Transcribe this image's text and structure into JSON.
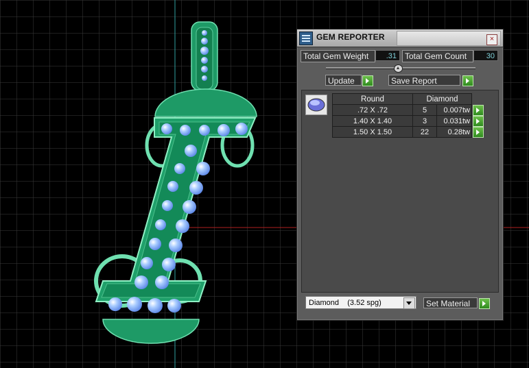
{
  "panel": {
    "title": "GEM REPORTER",
    "close_label": "×",
    "total_gem_weight_label": "Total Gem Weight",
    "total_gem_weight_value": ".31",
    "total_gem_count_label": "Total Gem Count",
    "total_gem_count_value": "30",
    "update_label": "Update",
    "save_report_label": "Save Report",
    "table": {
      "shape_header": "Round",
      "material_header": "Diamond",
      "rows": [
        {
          "size": ".72 X .72",
          "count": "5",
          "weight": "0.007tw"
        },
        {
          "size": "1.40 X 1.40",
          "count": "3",
          "weight": "0.031tw"
        },
        {
          "size": "1.50 X 1.50",
          "count": "22",
          "weight": "0.28tw"
        }
      ]
    },
    "material_select": "Diamond    (3.52 spg)",
    "set_material_label": "Set Material"
  },
  "colors": {
    "grid": "#3a3a3a",
    "model_green": "#1fa06a",
    "gem_blue": "#7fb3ff",
    "axis_red": "#c02020",
    "axis_cyan": "#30a0a0"
  }
}
